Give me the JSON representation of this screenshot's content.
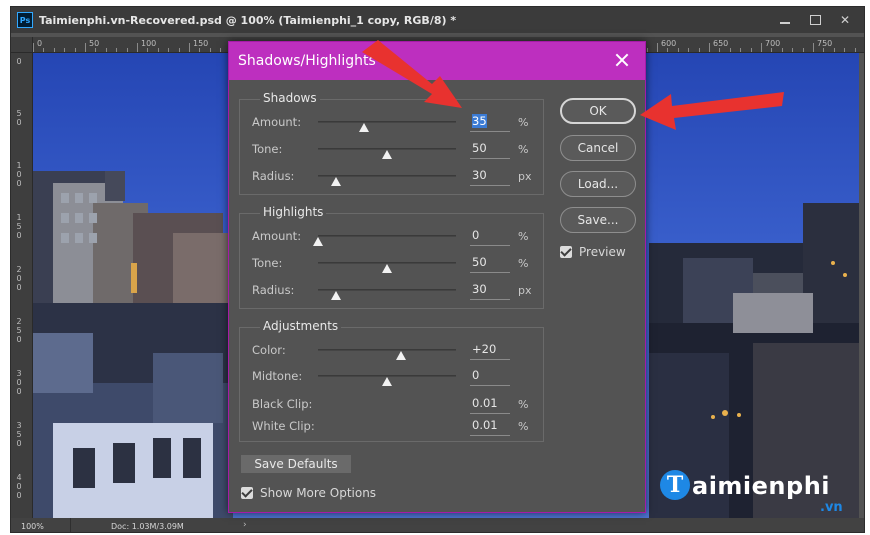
{
  "window": {
    "title": "Taimienphi.vn-Recovered.psd @ 100% (Taimienphi_1 copy, RGB/8) *",
    "app_logo": "Ps",
    "close_glyph": "✕"
  },
  "ruler": {
    "top_labels": [
      "0",
      "50",
      "100",
      "150",
      "600",
      "650",
      "700",
      "750"
    ],
    "left_labels": [
      "0",
      "5\n0",
      "1\n0\n0",
      "1\n5\n0",
      "2\n0\n0",
      "2\n5\n0",
      "3\n0\n0",
      "3\n5\n0",
      "4\n0\n0"
    ]
  },
  "status": {
    "zoom": "100%",
    "doc": "Doc: 1.03M/3.09M",
    "arrow": "›"
  },
  "watermark": {
    "logo_letter": "T",
    "text": "aimienphi",
    "tld": ".vn"
  },
  "dialog": {
    "title": "Shadows/Highlights",
    "shadows": {
      "title": "Shadows",
      "amount": {
        "label": "Amount:",
        "value": "35",
        "unit": "%",
        "fraction": 0.33
      },
      "tone": {
        "label": "Tone:",
        "value": "50",
        "unit": "%",
        "fraction": 0.5
      },
      "radius": {
        "label": "Radius:",
        "value": "30",
        "unit": "px",
        "fraction": 0.13
      }
    },
    "highlights": {
      "title": "Highlights",
      "amount": {
        "label": "Amount:",
        "value": "0",
        "unit": "%",
        "fraction": 0.0
      },
      "tone": {
        "label": "Tone:",
        "value": "50",
        "unit": "%",
        "fraction": 0.5
      },
      "radius": {
        "label": "Radius:",
        "value": "30",
        "unit": "px",
        "fraction": 0.13
      }
    },
    "adjustments": {
      "title": "Adjustments",
      "color": {
        "label": "Color:",
        "value": "+20",
        "fraction": 0.6
      },
      "midtone": {
        "label": "Midtone:",
        "value": "0",
        "fraction": 0.5
      },
      "black_clip": {
        "label": "Black Clip:",
        "value": "0.01",
        "unit": "%"
      },
      "white_clip": {
        "label": "White Clip:",
        "value": "0.01",
        "unit": "%"
      }
    },
    "buttons": {
      "ok": "OK",
      "cancel": "Cancel",
      "load": "Load...",
      "save": "Save...",
      "save_defaults": "Save Defaults"
    },
    "preview": {
      "label": "Preview",
      "checked": true
    },
    "show_more": {
      "label": "Show More Options",
      "checked": true
    }
  },
  "colors": {
    "dialog_title_bar": "#bd2fbf",
    "arrow": "#e8322f",
    "ps_background": "#535353"
  }
}
